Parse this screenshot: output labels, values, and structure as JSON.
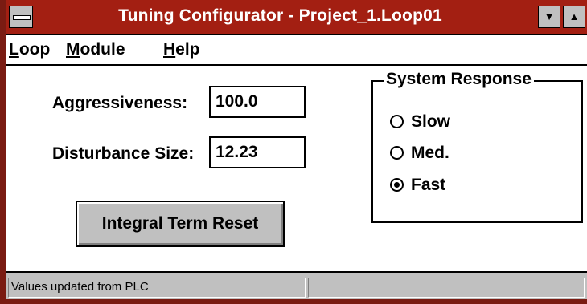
{
  "window": {
    "title": "Tuning Configurator - Project_1.Loop01",
    "minimize_glyph": "▼",
    "maximize_glyph": "▲"
  },
  "menu": {
    "items": [
      {
        "accel": "L",
        "rest": "oop"
      },
      {
        "accel": "M",
        "rest": "odule"
      },
      {
        "accel": "H",
        "rest": "elp"
      }
    ]
  },
  "form": {
    "aggressiveness_label": "Aggressiveness:",
    "aggressiveness_value": "100.0",
    "disturbance_label": "Disturbance Size:",
    "disturbance_value": "12.23",
    "reset_button": "Integral Term Reset"
  },
  "system_response": {
    "title": "System Response",
    "options": [
      {
        "label": "Slow",
        "selected": false
      },
      {
        "label": "Med.",
        "selected": false
      },
      {
        "label": "Fast",
        "selected": true
      }
    ]
  },
  "status": {
    "message": "Values updated from PLC",
    "secondary": ""
  }
}
